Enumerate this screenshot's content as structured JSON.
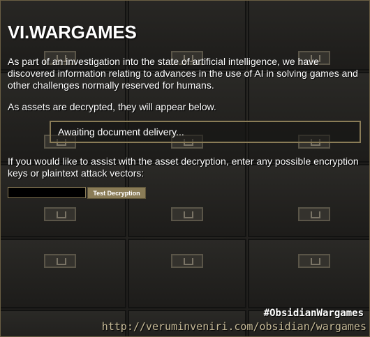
{
  "title": "VI.WARGAMES",
  "intro": "As part of an investigation into the state of artificial intelligence, we have discovered information relating to advances in the use of AI in solving games and other challenges normally reserved for humans.",
  "assets_note": "As assets are decrypted, they will appear below.",
  "delivery_status": "Awaiting document delivery...",
  "assist_prompt": "If you would like to assist with the asset decryption, enter any possible encryption keys or plaintext attack vectors:",
  "key_input": {
    "value": "",
    "placeholder": ""
  },
  "test_button_label": "Test Decryption",
  "hashtag": "#ObsidianWargames",
  "url": "http://veruminveniri.com/obsidian/wargames",
  "colors": {
    "accent": "#8a7c57",
    "background": "#1e1d1b",
    "text": "#ffffff",
    "url_text": "#c7bb98"
  }
}
